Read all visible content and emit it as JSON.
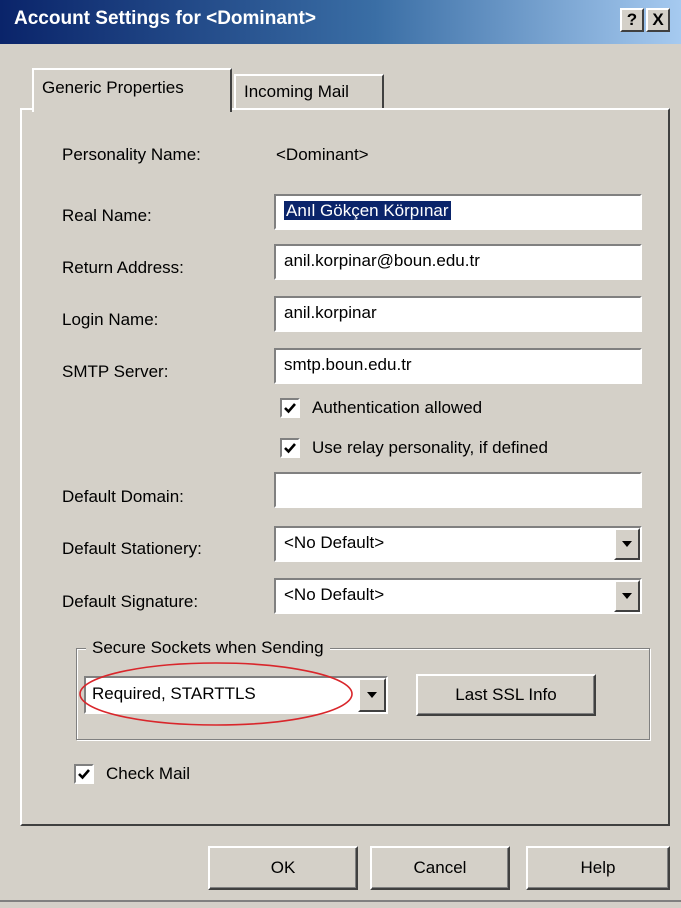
{
  "window": {
    "title": "Account Settings for <Dominant>",
    "help_btn": "?",
    "close_btn": "X"
  },
  "tabs": [
    {
      "label": "Generic Properties",
      "active": true
    },
    {
      "label": "Incoming Mail",
      "active": false
    }
  ],
  "form": {
    "personality_label": "Personality Name:",
    "personality_value": "<Dominant>",
    "real_name_label": "Real Name:",
    "real_name_value": "Anıl Gökçen Körpınar",
    "return_address_label": "Return Address:",
    "return_address_value": "anil.korpinar@boun.edu.tr",
    "login_name_label": "Login Name:",
    "login_name_value": "anil.korpinar",
    "smtp_label": "SMTP Server:",
    "smtp_value": "smtp.boun.edu.tr",
    "auth_label": "Authentication allowed",
    "auth_checked": true,
    "relay_label": "Use relay personality, if defined",
    "relay_checked": true,
    "domain_label": "Default Domain:",
    "domain_value": "",
    "stationery_label": "Default Stationery:",
    "stationery_value": "<No Default>",
    "signature_label": "Default Signature:",
    "signature_value": "<No Default>"
  },
  "ssl": {
    "group_label": "Secure Sockets when Sending",
    "value": "Required, STARTTLS",
    "info_button": "Last SSL Info"
  },
  "check_mail": {
    "label": "Check Mail",
    "checked": true
  },
  "buttons": {
    "ok": "OK",
    "cancel": "Cancel",
    "help": "Help"
  },
  "colors": {
    "dialog_bg": "#d4d0c8",
    "title_start": "#0a246a",
    "title_end": "#a6caf0",
    "highlight_ellipse": "#d9262b"
  }
}
